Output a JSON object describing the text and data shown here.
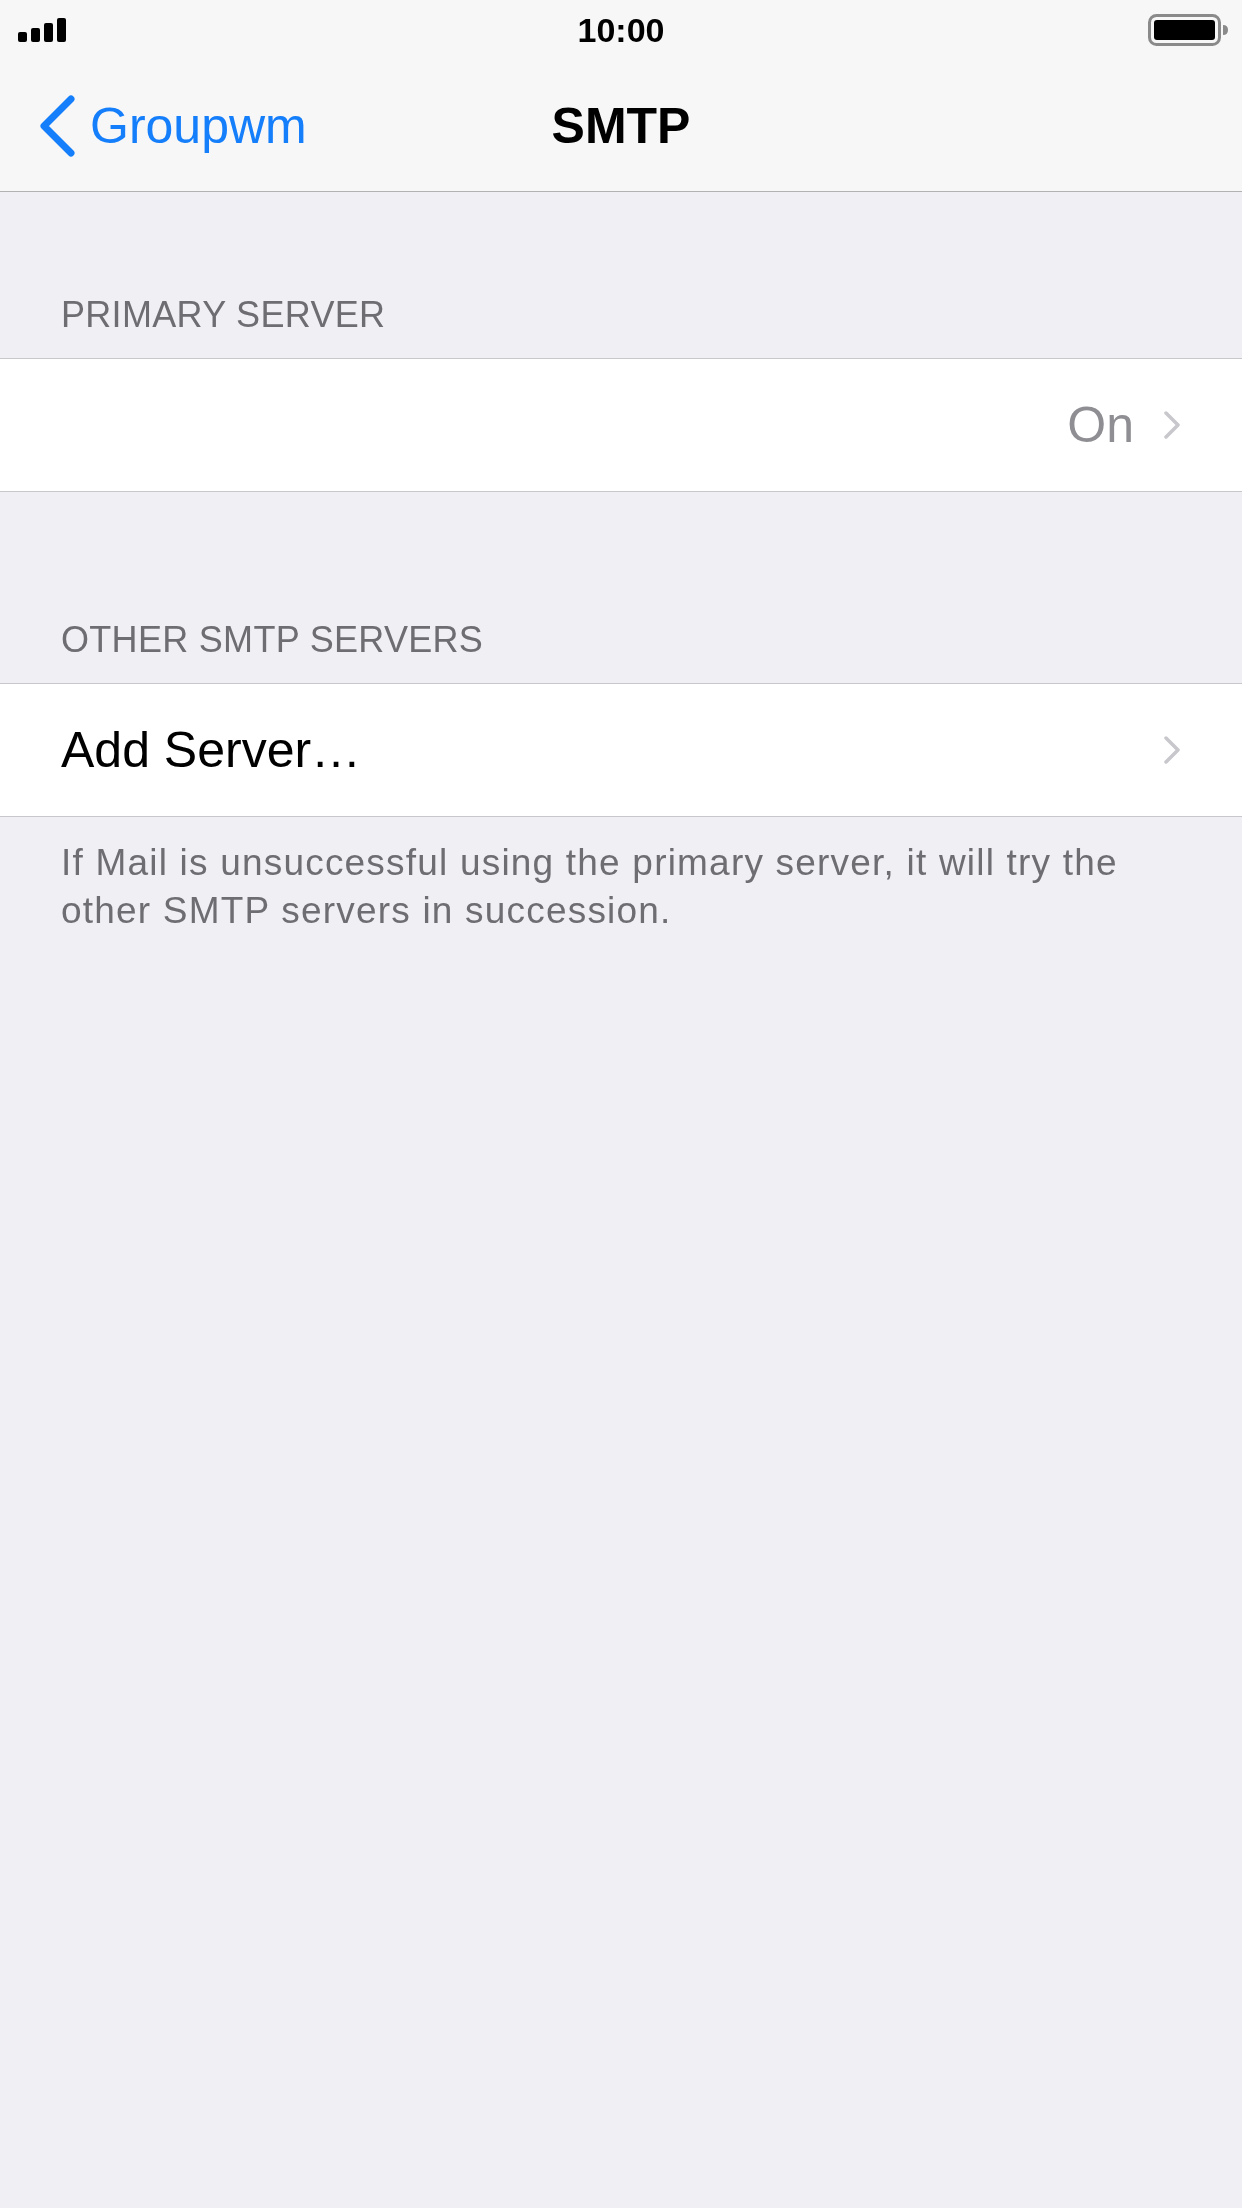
{
  "status_bar": {
    "time": "10:00"
  },
  "nav_bar": {
    "back_label": "Groupwm",
    "title": "SMTP"
  },
  "sections": [
    {
      "header": "PRIMARY SERVER",
      "rows": [
        {
          "value": "On"
        }
      ]
    },
    {
      "header": "OTHER SMTP SERVERS",
      "rows": [
        {
          "label": "Add Server…"
        }
      ],
      "footer": "If Mail is unsuccessful using the primary server, it will try the other SMTP servers in succession."
    }
  ]
}
